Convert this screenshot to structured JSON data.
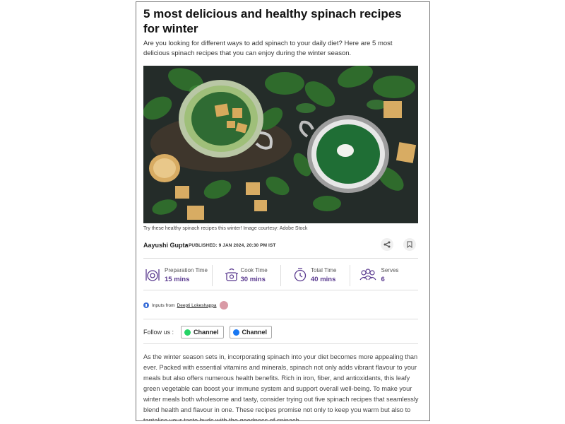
{
  "article": {
    "title": "5 most delicious and healthy spinach recipes for winter",
    "summary": "Are you looking for different ways to add spinach to your daily diet? Here are 5 most delicious spinach recipes that you can enjoy during the winter season.",
    "image_caption": "Try these healthy spinach recipes this winter! Image courtesy: Adobe Stock",
    "author": "Aayushi Gupta",
    "published": "PUBLISHED: 9 JAN 2024, 20:30 PM IST",
    "body": "As the winter season sets in, incorporating spinach into your diet becomes more appealing than ever. Packed with essential vitamins and minerals, spinach not only adds vibrant flavour to your meals but also offers numerous health benefits. Rich in iron, fiber, and antioxidants, this leafy green vegetable can boost your immune system and support overall well-being. To make your winter meals both wholesome and tasty, consider trying out five spinach recipes that seamlessly blend health and flavour in one. These recipes promise not only to keep you warm but also to tantalise your taste buds with the goodness of spinach."
  },
  "actions": {
    "share_icon": "share-icon",
    "bookmark_icon": "bookmark-icon"
  },
  "stats": [
    {
      "label": "Preparation Time",
      "value": "15 mins",
      "icon": "prep-icon"
    },
    {
      "label": "Cook Time",
      "value": "30 mins",
      "icon": "cook-pot-icon"
    },
    {
      "label": "Total Time",
      "value": "40 mins",
      "icon": "total-time-icon"
    },
    {
      "label": "Serves",
      "value": "6",
      "icon": "people-icon"
    }
  ],
  "inputs": {
    "prefix": "Inputs from",
    "expert": "Deepti Lokeshappa"
  },
  "follow": {
    "label": "Follow us :",
    "whatsapp": "Channel",
    "facebook": "Channel"
  },
  "colors": {
    "accent": "#5a3a8f",
    "whatsapp": "#25d366",
    "facebook": "#1877f2"
  }
}
